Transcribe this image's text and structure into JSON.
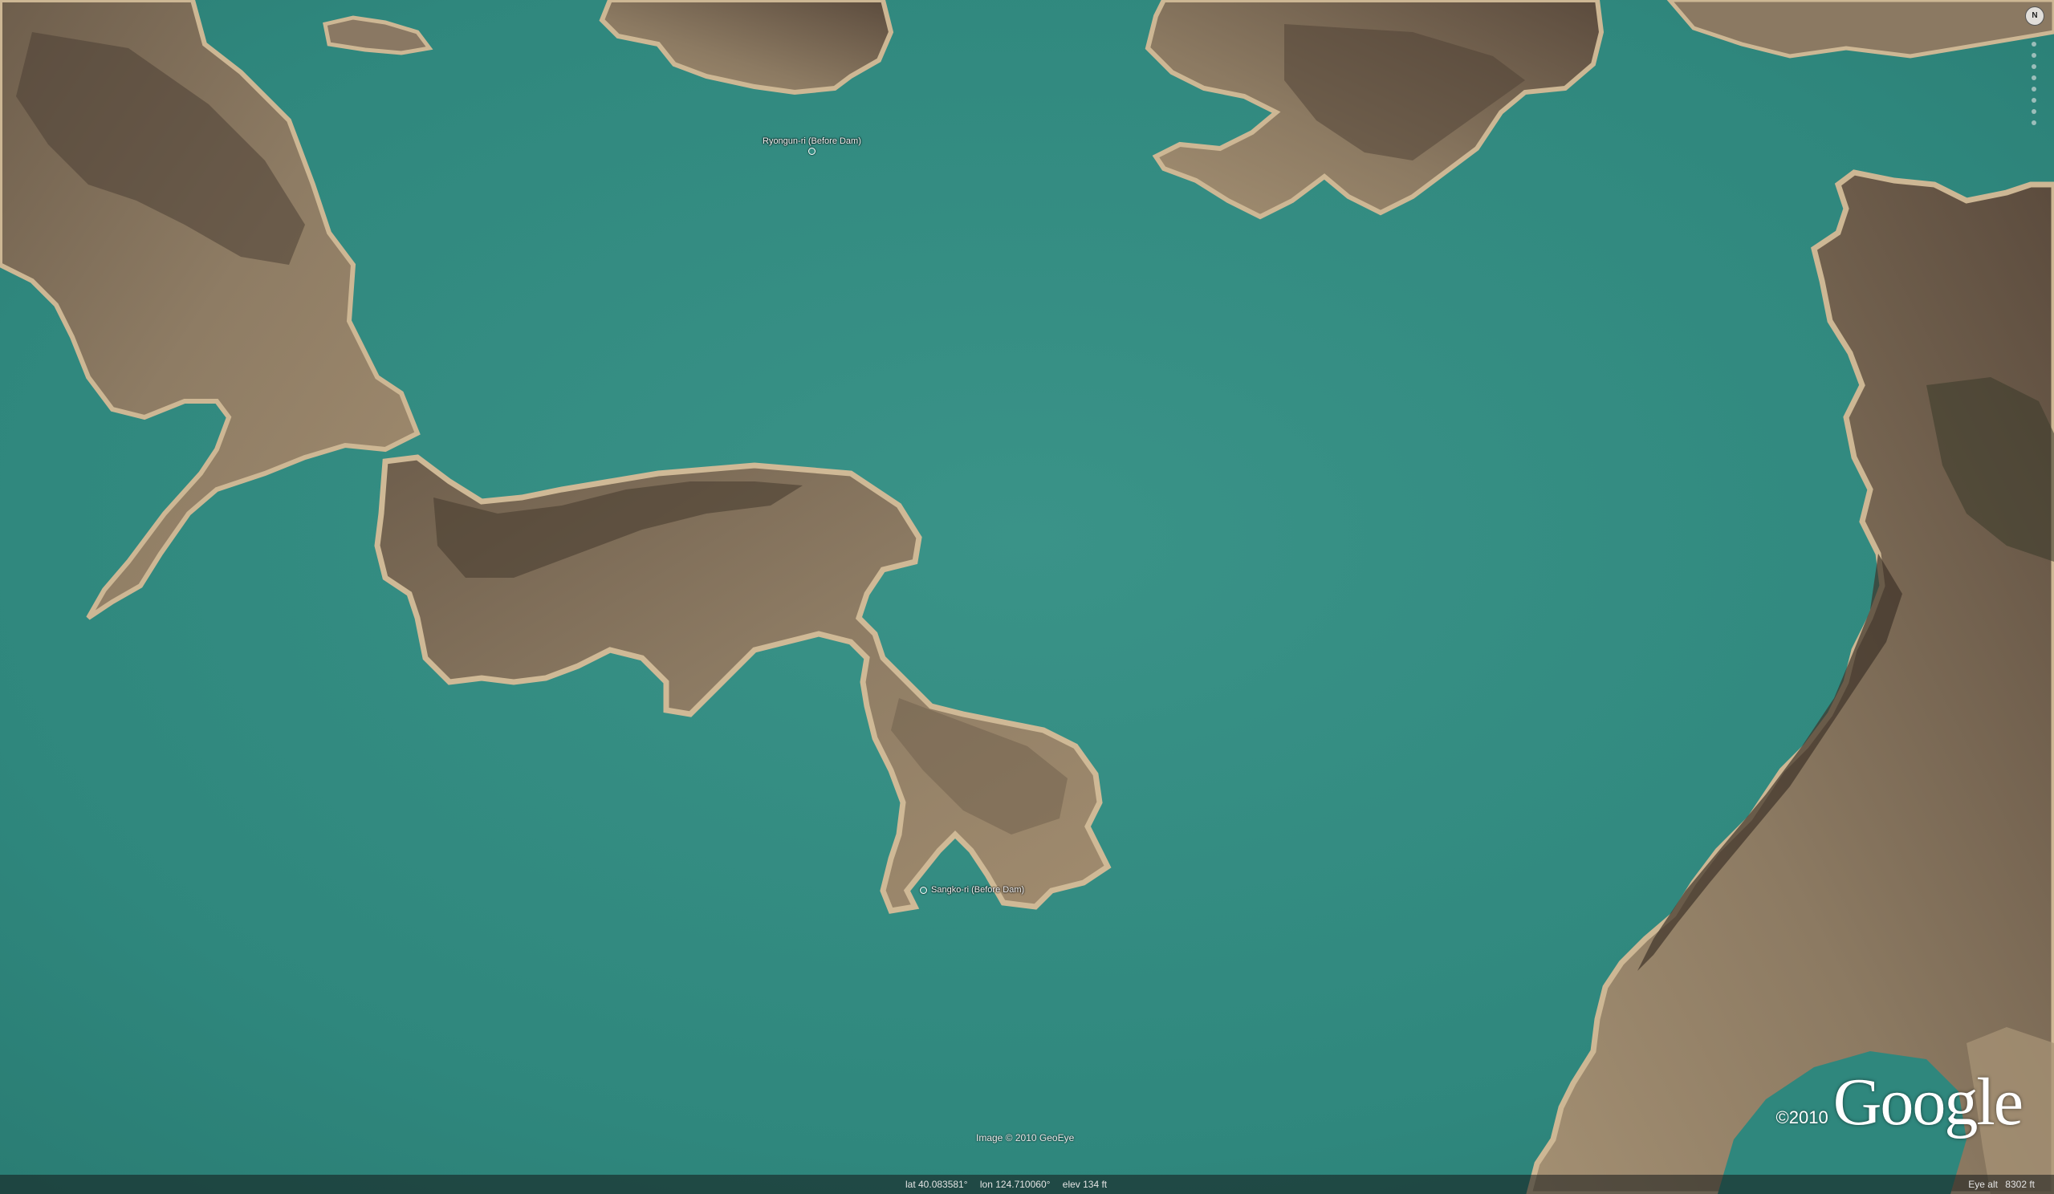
{
  "map": {
    "placemarks": [
      {
        "name": "ryongun-ri",
        "label": "Ryongun-ri (Before Dam)"
      },
      {
        "name": "sangko-ri",
        "label": "Sangko-ri (Before Dam)"
      }
    ],
    "imagery_credit": "Image © 2010 GeoEye",
    "brand": {
      "year": "©2010",
      "logo": "Google"
    },
    "compass_letter": "N"
  },
  "statusbar": {
    "lat": "lat   40.083581°",
    "lon": "lon   124.710060°",
    "elev": "elev   134 ft",
    "eye_label": "Eye alt",
    "eye_value": "8302 ft"
  },
  "colors": {
    "water": "#2f8a80",
    "land": "#8a7a62",
    "land_dark": "#4f4236",
    "shore": "#cbb594"
  }
}
